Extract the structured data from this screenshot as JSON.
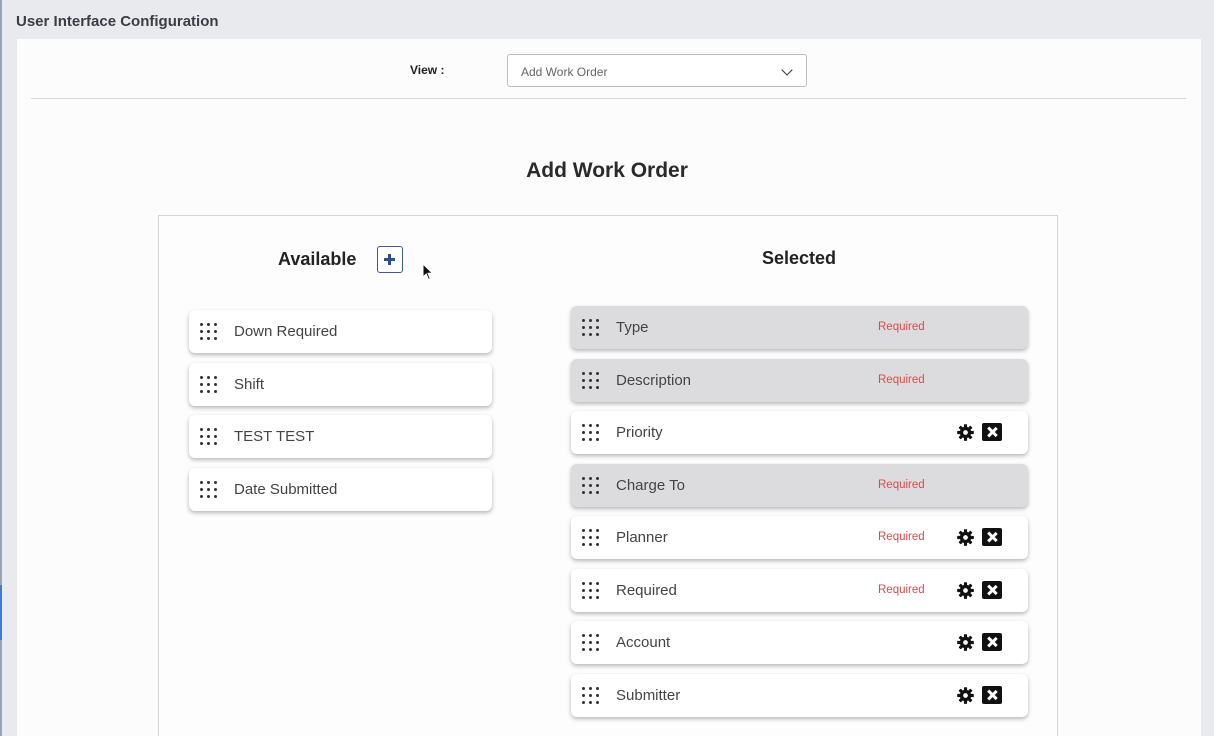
{
  "page": {
    "title": "User Interface Configuration"
  },
  "view_selector": {
    "label": "View :",
    "value": "Add Work Order"
  },
  "form": {
    "title": "Add Work Order"
  },
  "available": {
    "heading": "Available",
    "items": [
      {
        "label": "Down Required"
      },
      {
        "label": "Shift"
      },
      {
        "label": "TEST TEST"
      },
      {
        "label": "Date Submitted"
      }
    ]
  },
  "selected": {
    "heading": "Selected",
    "required_text": "Required",
    "items": [
      {
        "label": "Type",
        "required": true,
        "locked": true
      },
      {
        "label": "Description",
        "required": true,
        "locked": true
      },
      {
        "label": "Priority",
        "required": false,
        "locked": false
      },
      {
        "label": "Charge To",
        "required": true,
        "locked": true
      },
      {
        "label": "Planner",
        "required": true,
        "locked": false
      },
      {
        "label": "Required",
        "required": true,
        "locked": false
      },
      {
        "label": "Account",
        "required": false,
        "locked": false
      },
      {
        "label": "Submitter",
        "required": false,
        "locked": false
      }
    ]
  },
  "colors": {
    "required": "#e04848",
    "accent": "#2c4f8f",
    "locked_card": "#dcdcde"
  }
}
